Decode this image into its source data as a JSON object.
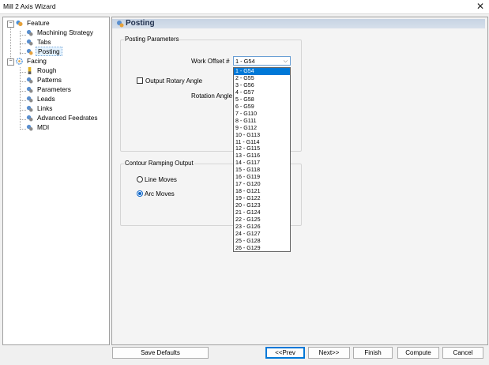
{
  "window": {
    "title": "Mill 2 Axis Wizard",
    "close_glyph": "✕"
  },
  "tree": {
    "items": [
      {
        "label": "Feature",
        "icon": "feature-icon"
      },
      {
        "label": "Machining Strategy",
        "icon": "gear-icon"
      },
      {
        "label": "Tabs",
        "icon": "gear-icon"
      },
      {
        "label": "Posting",
        "icon": "gear-icon",
        "selected": true
      },
      {
        "label": "Facing",
        "icon": "facing-icon"
      },
      {
        "label": "Rough",
        "icon": "tool-icon"
      },
      {
        "label": "Patterns",
        "icon": "gear-icon"
      },
      {
        "label": "Parameters",
        "icon": "gear-icon"
      },
      {
        "label": "Leads",
        "icon": "gear-icon"
      },
      {
        "label": "Links",
        "icon": "gear-icon"
      },
      {
        "label": "Advanced Feedrates",
        "icon": "gear-icon"
      },
      {
        "label": "MDI",
        "icon": "gear-icon"
      }
    ]
  },
  "header": {
    "title": "Posting"
  },
  "posting_parameters": {
    "group_title": "Posting Parameters",
    "work_offset_label": "Work Offset #",
    "work_offset_value": "1 - G54",
    "output_rotary_label": "Output Rotary Angle",
    "rotation_angle_label": "Rotation Angle"
  },
  "work_offset_options": [
    "1 - G54",
    "2 - G55",
    "3 - G56",
    "4 - G57",
    "5 - G58",
    "6 - G59",
    "7 - G110",
    "8 - G111",
    "9 - G112",
    "10 - G113",
    "11 - G114",
    "12 - G115",
    "13 - G116",
    "14 - G117",
    "15 - G118",
    "16 - G119",
    "17 - G120",
    "18 - G121",
    "19 - G122",
    "20 - G123",
    "21 - G124",
    "22 - G125",
    "23 - G126",
    "24 - G127",
    "25 - G128",
    "26 - G129"
  ],
  "contour_ramping": {
    "group_title": "Contour Ramping Output",
    "line_moves_label": "Line Moves",
    "arc_moves_label": "Arc Moves",
    "selected": "Arc Moves"
  },
  "buttons": {
    "save_defaults": "Save Defaults",
    "prev": "<<Prev",
    "next": "Next>>",
    "finish": "Finish",
    "compute": "Compute",
    "cancel": "Cancel"
  },
  "colors": {
    "selection_blue": "#0078d7",
    "header_bar": "#c7d3e3",
    "header_text": "#1f2f4c"
  }
}
